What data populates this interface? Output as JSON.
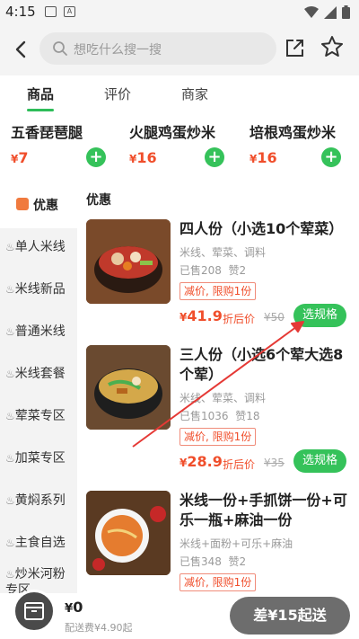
{
  "status": {
    "time": "4:15"
  },
  "search": {
    "placeholder": "想吃什么搜一搜"
  },
  "tabs": [
    "商品",
    "评价",
    "商家"
  ],
  "recommend": [
    {
      "name": "五香琵琶腿",
      "price": "7"
    },
    {
      "name": "火腿鸡蛋炒米",
      "price": "16"
    },
    {
      "name": "培根鸡蛋炒米",
      "price": "16"
    }
  ],
  "sidebar": {
    "active": "优惠",
    "items": [
      "单人米线",
      "米线新品",
      "普通米线",
      "米线套餐",
      "荤菜专区",
      "加菜专区",
      "黄焖系列",
      "主食自选",
      "炒米河粉专区"
    ]
  },
  "section_title": "优惠",
  "items": [
    {
      "name": "四人份（小选10个荤菜）",
      "desc": "米线、荤菜、调料",
      "sold": "已售208",
      "likes": "赞2",
      "promo": "减价, 限购1份",
      "price": "41.9",
      "discount": "折后价",
      "original": "¥50",
      "button": "选规格"
    },
    {
      "name": "三人份（小选6个荤大选8个荤）",
      "desc": "米线、荤菜、调料",
      "sold": "已售1036",
      "likes": "赞18",
      "promo": "减价, 限购1份",
      "price": "28.9",
      "discount": "折后价",
      "original": "¥35",
      "button": "选规格"
    },
    {
      "name": "米线一份+手抓饼一份+可乐一瓶+麻油一份",
      "desc": "米线+面粉+可乐+麻油",
      "sold": "已售348",
      "likes": "赞2",
      "promo": "减价, 限购1份"
    }
  ],
  "cart": {
    "total": "0",
    "fee": "配送费¥4.90起",
    "checkout": "差¥15起送"
  },
  "currency": "¥",
  "colors": {
    "accent_green": "#35c25a",
    "price_red": "#f04e2b",
    "annotation_arrow": "#e53935"
  }
}
